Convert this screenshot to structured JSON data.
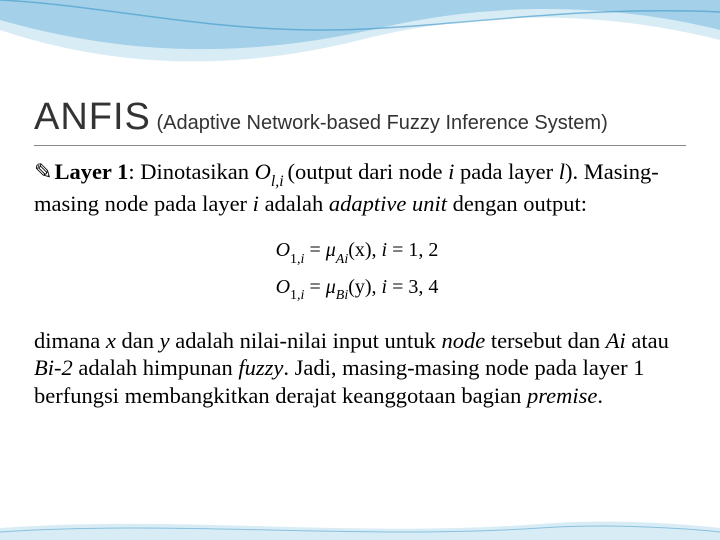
{
  "title": {
    "main": "ANFIS",
    "sub": " (Adaptive Network-based Fuzzy Inference System)"
  },
  "para1": {
    "bullet": "✎",
    "t1": "Layer 1",
    "t2": ": Dinotasikan ",
    "t3": "O",
    "t4": "l,i ",
    "t5": "(output dari node ",
    "t6": "i",
    "t7": " pada layer ",
    "t8": "l",
    "t9": "). Masing-masing node pada layer ",
    "t10": "i",
    "t11": " adalah ",
    "t12": "adaptive unit",
    "t13": " dengan output:"
  },
  "eq": {
    "r1_a": "O",
    "r1_b": "1,",
    "r1_c": "i",
    "r1_d": " = ",
    "r1_e": "μ",
    "r1_f": "Ai",
    "r1_g": "(x),   ",
    "r1_h": "i",
    "r1_i": " = 1, 2",
    "r2_a": "O",
    "r2_b": "1,",
    "r2_c": "i",
    "r2_d": " = ",
    "r2_e": "μ",
    "r2_f": "Bi",
    "r2_g": "(y),   ",
    "r2_h": "i",
    "r2_i": " = 3, 4"
  },
  "para2": {
    "t1": "dimana ",
    "t2": "x",
    "t3": " dan ",
    "t4": "y",
    "t5": " adalah nilai-nilai input untuk ",
    "t6": "node",
    "t7": " tersebut dan ",
    "t8": "Ai",
    "t9": " atau ",
    "t10": "Bi-2",
    "t11": " adalah himpunan ",
    "t12": "fuzzy",
    "t13": ". Jadi, masing-masing node pada layer 1 berfungsi membangkitkan derajat keanggotaan bagian ",
    "t14": "premise",
    "t15": "."
  }
}
